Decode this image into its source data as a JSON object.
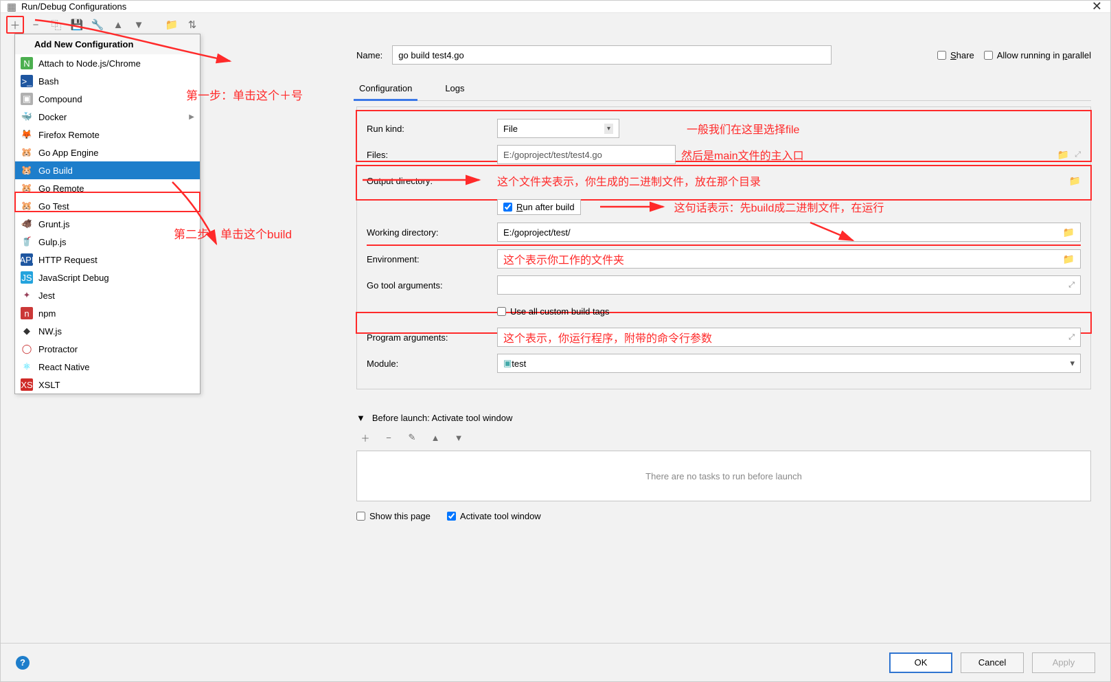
{
  "window": {
    "title": "Run/Debug Configurations",
    "close": "✕"
  },
  "toolbar": {
    "add": "＋",
    "remove": "−",
    "copy": "⿻",
    "save": "💾",
    "wrench": "🔧",
    "up": "▲",
    "down": "▼",
    "folder": "📁",
    "sort": "⇅"
  },
  "popup": {
    "header": "Add New Configuration",
    "items": [
      {
        "label": "Attach to Node.js/Chrome",
        "iconTxt": "N",
        "bg": "#4caf50",
        "fg": "#fff"
      },
      {
        "label": "Bash",
        "iconTxt": ">_",
        "bg": "#1e56a0",
        "fg": "#fff"
      },
      {
        "label": "Compound",
        "iconTxt": "▣",
        "bg": "#b0b0b0",
        "fg": "#fff"
      },
      {
        "label": "Docker",
        "iconTxt": "🐳",
        "bg": "",
        "fg": "#2396ed",
        "chev": true
      },
      {
        "label": "Firefox Remote",
        "iconTxt": "🦊",
        "bg": "",
        "fg": "#ff7139"
      },
      {
        "label": "Go App Engine",
        "iconTxt": "🐹",
        "bg": "",
        "fg": "#00add8"
      },
      {
        "label": "Go Build",
        "iconTxt": "🐹",
        "bg": "",
        "fg": "#00add8",
        "selected": true
      },
      {
        "label": "Go Remote",
        "iconTxt": "🐹",
        "bg": "",
        "fg": "#00add8"
      },
      {
        "label": "Go Test",
        "iconTxt": "🐹",
        "bg": "",
        "fg": "#00add8"
      },
      {
        "label": "Grunt.js",
        "iconTxt": "🐗",
        "bg": "",
        "fg": "#b0651d"
      },
      {
        "label": "Gulp.js",
        "iconTxt": "🥤",
        "bg": "",
        "fg": "#cf4647"
      },
      {
        "label": "HTTP Request",
        "iconTxt": "API",
        "bg": "#1e56a0",
        "fg": "#fff"
      },
      {
        "label": "JavaScript Debug",
        "iconTxt": "JS",
        "bg": "#23a3dd",
        "fg": "#fff"
      },
      {
        "label": "Jest",
        "iconTxt": "✦",
        "bg": "",
        "fg": "#99425b"
      },
      {
        "label": "npm",
        "iconTxt": "n",
        "bg": "#cb3837",
        "fg": "#fff"
      },
      {
        "label": "NW.js",
        "iconTxt": "◆",
        "bg": "",
        "fg": "#333"
      },
      {
        "label": "Protractor",
        "iconTxt": "◯",
        "bg": "",
        "fg": "#c62828"
      },
      {
        "label": "React Native",
        "iconTxt": "⚛",
        "bg": "",
        "fg": "#00d8ff"
      },
      {
        "label": "XSLT",
        "iconTxt": "XS",
        "bg": "#cf2a27",
        "fg": "#fff"
      }
    ]
  },
  "name": {
    "label": "Name:",
    "value": "go build test4.go"
  },
  "share": {
    "label": "Share"
  },
  "parallel": {
    "label": "Allow running in parallel"
  },
  "tabs": {
    "config": "Configuration",
    "logs": "Logs"
  },
  "form": {
    "runkind_label": "Run kind:",
    "runkind_value": "File",
    "files_label": "Files:",
    "files_value": "E:/goproject/test/test4.go",
    "outdir_label": "Output directory:",
    "run_after": "Run after build",
    "workdir_label": "Working directory:",
    "workdir_value": "E:/goproject/test/",
    "env_label": "Environment:",
    "goargs_label": "Go tool arguments:",
    "custom_tags": "Use all custom build tags",
    "progargs_label": "Program arguments:",
    "module_label": "Module:",
    "module_value": "test"
  },
  "annotations": {
    "step1": "第一步：单击这个＋号",
    "step2": "第二步：单击这个build",
    "runkind": "一般我们在这里选择file",
    "files": "然后是main文件的主入口",
    "outdir": "这个文件夹表示，你生成的二进制文件，放在那个目录",
    "runafter": "这句话表示：先build成二进制文件，在运行",
    "workdir": "这个表示你工作的文件夹",
    "progargs": "这个表示，你运行程序，附带的命令行参数"
  },
  "before": {
    "header": "Before launch: Activate tool window",
    "empty": "There are no tasks to run before launch",
    "show_page": "Show this page",
    "activate": "Activate tool window"
  },
  "footer": {
    "ok": "OK",
    "cancel": "Cancel",
    "apply": "Apply"
  }
}
